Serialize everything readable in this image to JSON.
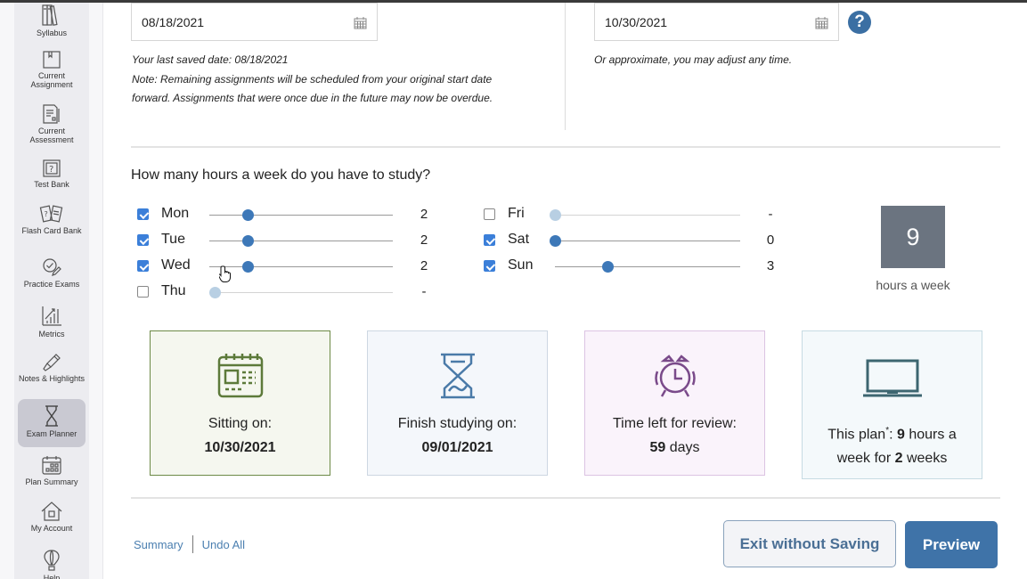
{
  "sidebar": {
    "items": [
      {
        "label": "Syllabus",
        "icon": "books-icon",
        "active": false
      },
      {
        "label": "Current Assignment",
        "icon": "notebook-icon",
        "active": false
      },
      {
        "label": "Current Assessment",
        "icon": "document-pen-icon",
        "active": false
      },
      {
        "label": "Test Bank",
        "icon": "question-book-icon",
        "active": false
      },
      {
        "label": "Flash Card Bank",
        "icon": "flash-cards-icon",
        "active": false
      },
      {
        "label": "Practice Exams",
        "icon": "check-pencil-icon",
        "active": false
      },
      {
        "label": "Metrics",
        "icon": "bar-chart-icon",
        "active": false
      },
      {
        "label": "Notes & Highlights",
        "icon": "highlighter-icon",
        "active": false
      },
      {
        "label": "Exam Planner",
        "icon": "hourglass-icon",
        "active": true
      },
      {
        "label": "Plan Summary",
        "icon": "calendar-grid-icon",
        "active": false
      },
      {
        "label": "My Account",
        "icon": "house-icon",
        "active": false
      },
      {
        "label": "Help",
        "icon": "hot-air-balloon-icon",
        "active": false
      }
    ]
  },
  "start_date": {
    "value": "08/18/2021",
    "note_saved": "Your last saved date: 08/18/2021",
    "note": "Note: Remaining assignments will be scheduled from your original start date forward. Assignments that were once due in the future may now be overdue."
  },
  "exam_date": {
    "value": "10/30/2021",
    "note": "Or approximate, you may adjust any time."
  },
  "hours": {
    "question": "How many hours a week do you have to study?",
    "slider_max": 12,
    "days": [
      {
        "label": "Mon",
        "checked": true,
        "value": 2,
        "display": "2"
      },
      {
        "label": "Tue",
        "checked": true,
        "value": 2,
        "display": "2"
      },
      {
        "label": "Wed",
        "checked": true,
        "value": 2,
        "display": "2"
      },
      {
        "label": "Thu",
        "checked": false,
        "value": 0,
        "display": "-"
      },
      {
        "label": "Fri",
        "checked": false,
        "value": 0,
        "display": "-"
      },
      {
        "label": "Sat",
        "checked": true,
        "value": 0,
        "display": "0"
      },
      {
        "label": "Sun",
        "checked": true,
        "value": 3,
        "display": "3"
      }
    ],
    "total": "9",
    "total_label": "hours a week"
  },
  "cards": {
    "sitting": {
      "label": "Sitting on:",
      "value": "10/30/2021",
      "color": "#5d7a3a"
    },
    "finish": {
      "label": "Finish studying on:",
      "value": "09/01/2021",
      "color": "#4a7aa8"
    },
    "review": {
      "label": "Time left for review:",
      "value": "59",
      "suffix": " days",
      "color": "#7a4a8a"
    },
    "plan": {
      "prefix": "This plan",
      "asterisk": "*",
      "mid1": ": ",
      "hours": "9",
      "mid2": " hours a",
      "mid3": "week for ",
      "weeks": "2",
      "suffix": " weeks",
      "color": "#3d6670"
    }
  },
  "footer": {
    "summary_link": "Summary",
    "undo_link": "Undo All",
    "exit_button": "Exit without Saving",
    "preview_button": "Preview"
  },
  "colors": {
    "accent": "#3f73a8",
    "slider_active": "#3d78b8",
    "slider_inactive": "#b8cfe3",
    "total_box": "#6b7480"
  }
}
